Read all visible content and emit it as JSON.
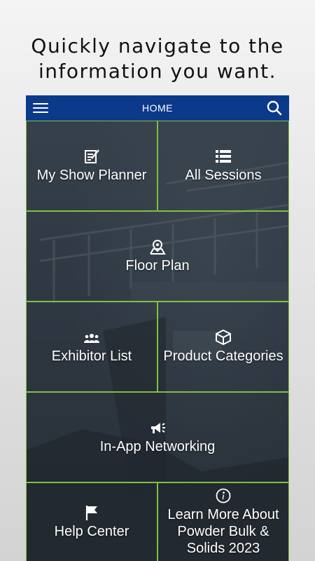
{
  "promo": {
    "line1": "Quickly navigate to the",
    "line2": "information you want."
  },
  "header": {
    "title": "HOME",
    "menu_icon": "hamburger-menu-icon",
    "search_icon": "search-icon",
    "bar_color": "#0c3a8a"
  },
  "tiles": [
    {
      "label": "My Show Planner",
      "icon": "planner-icon"
    },
    {
      "label": "All Sessions",
      "icon": "list-icon"
    },
    {
      "label": "Floor Plan",
      "icon": "map-pin-icon"
    },
    {
      "label": "Exhibitor List",
      "icon": "people-icon"
    },
    {
      "label": "Product Categories",
      "icon": "box-icon"
    },
    {
      "label": "In-App Networking",
      "icon": "megaphone-icon"
    },
    {
      "label": "Help Center",
      "icon": "flag-icon"
    },
    {
      "label_lines": [
        "Learn More About",
        "Powder Bulk &",
        "Solids 2023"
      ],
      "icon": "info-icon"
    }
  ],
  "colors": {
    "tile_border": "#7cc242",
    "tile_text": "#ffffff"
  }
}
